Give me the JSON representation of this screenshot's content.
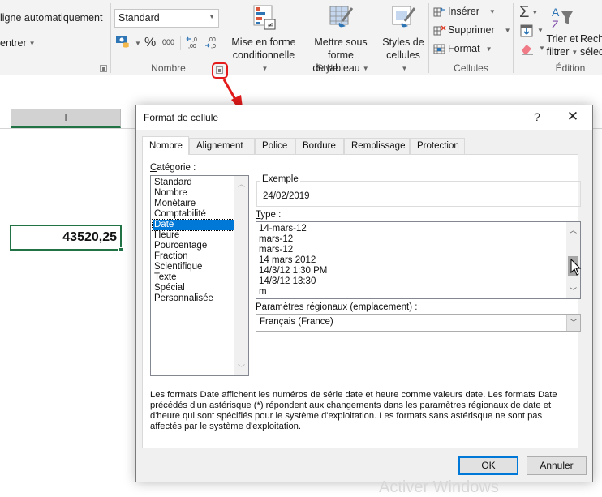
{
  "ribbon": {
    "alignment_group": {
      "wrap_text_label": "Renvoyer à la ligne automatiquement",
      "wrap_text_visible": "ligne automatiquement",
      "merge_center_visible": "entrer"
    },
    "number_group": {
      "label": "Nombre",
      "format_select_value": "Standard",
      "percent_symbol": "%",
      "thousands_symbol": "000",
      "increase_decimal_label": ",0 ,00",
      "decrease_decimal_label": ",00 ,0"
    },
    "style_group": {
      "label": "Style",
      "conditional_format_line1": "Mise en forme",
      "conditional_format_line2": "conditionnelle",
      "format_table_line1": "Mettre sous forme",
      "format_table_line2": "de tableau",
      "cell_styles_line1": "Styles de",
      "cell_styles_line2": "cellules"
    },
    "cells_group": {
      "label": "Cellules",
      "insert": "Insérer",
      "delete": "Supprimer",
      "format": "Format"
    },
    "editing_group": {
      "label": "Édition",
      "sort_filter_line1": "Trier et",
      "sort_filter_line2": "filtrer",
      "find_select_line1": "Rech",
      "find_select_line2": "sélec"
    }
  },
  "sheet": {
    "column_header": "I",
    "selected_cell_value": "43520,25"
  },
  "dialog": {
    "title": "Format de cellule",
    "help_glyph": "?",
    "close_glyph": "✕",
    "tabs": [
      {
        "label": "Nombre",
        "active": true
      },
      {
        "label": "Alignement",
        "active": false
      },
      {
        "label": "Police",
        "active": false
      },
      {
        "label": "Bordure",
        "active": false
      },
      {
        "label": "Remplissage",
        "active": false
      },
      {
        "label": "Protection",
        "active": false
      }
    ],
    "category_label_first": "C",
    "category_label_rest": "atégorie :",
    "categories": [
      "Standard",
      "Nombre",
      "Monétaire",
      "Comptabilité",
      "Date",
      "Heure",
      "Pourcentage",
      "Fraction",
      "Scientifique",
      "Texte",
      "Spécial",
      "Personnalisée"
    ],
    "selected_category": "Date",
    "example_legend": "Exemple",
    "example_value": "24/02/2019",
    "type_label_first": "T",
    "type_label_rest": "ype :",
    "type_items": [
      "14-mars-12",
      "mars-12",
      "mars-12",
      "14 mars 2012",
      "14/3/12 1:30 PM",
      "14/3/12 13:30",
      "m"
    ],
    "locale_label_first": "P",
    "locale_label_rest": "aramètres régionaux (emplacement) :",
    "locale_value": "Français (France)",
    "description": "Les formats Date affichent les numéros de série date et heure comme valeurs date. Les formats Date précédés d'un astérisque (*) répondent aux changements dans les paramètres régionaux de date et d'heure qui sont spécifiés pour le système d'exploitation. Les formats sans astérisque ne sont pas affectés par le système d'exploitation.",
    "ok_label": "OK",
    "cancel_label": "Annuler"
  },
  "colors": {
    "excel_green": "#217346",
    "selection_blue": "#0078d7",
    "annotation_red": "#e41b1b"
  },
  "watermark": "Activer Windows"
}
